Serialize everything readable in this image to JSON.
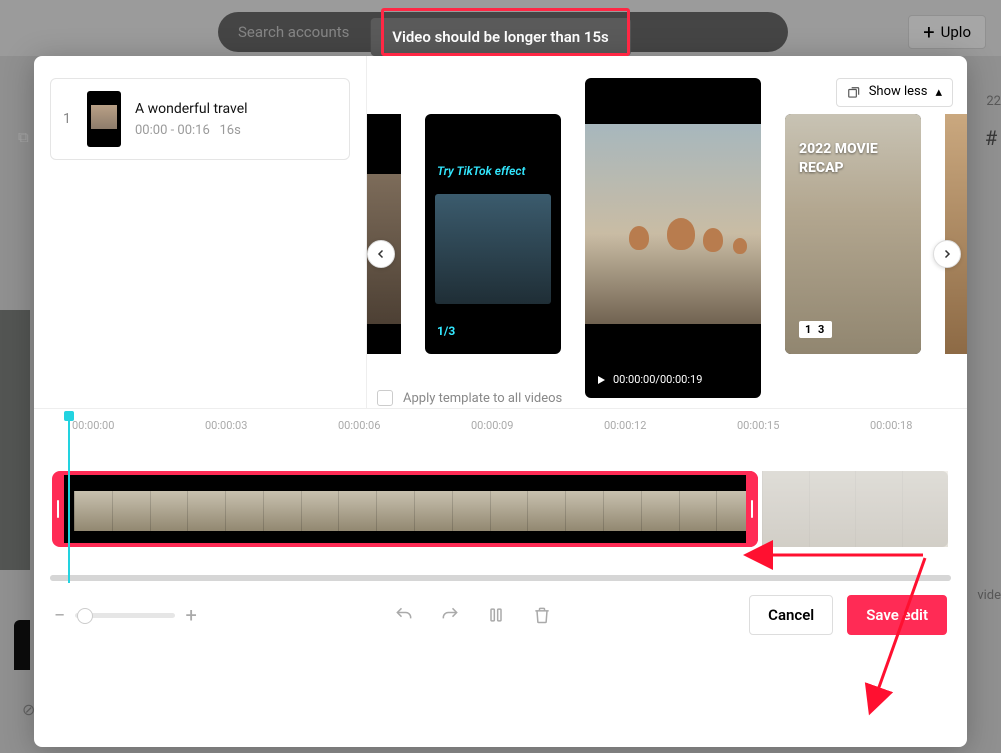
{
  "background": {
    "search_placeholder": "Search accounts",
    "upload_label": "Uplo",
    "right_num": "22",
    "hashtag": "#",
    "right_vide": "vide"
  },
  "toast": {
    "message": "Video should be longer than 15s"
  },
  "sidebar_clip": {
    "index": "1",
    "title": "A wonderful travel",
    "range": "00:00 - 00:16",
    "duration": "16s"
  },
  "show_less": {
    "label": "Show less"
  },
  "templates": {
    "a_effect": "Try TikTok effect",
    "a_counter": "1/3",
    "b_time_cur": "00:00:00",
    "b_time_total": "00:00:19",
    "c_title": "2022 MOVIE RECAP",
    "c_counter": "1 3"
  },
  "apply_all": {
    "label": "Apply template to all videos"
  },
  "ruler_ticks": [
    "00:00:00",
    "00:00:03",
    "00:00:06",
    "00:00:09",
    "00:00:12",
    "00:00:15",
    "00:00:18"
  ],
  "zoom": {
    "minus": "−",
    "plus": "+"
  },
  "buttons": {
    "cancel": "Cancel",
    "save": "Save edit"
  }
}
